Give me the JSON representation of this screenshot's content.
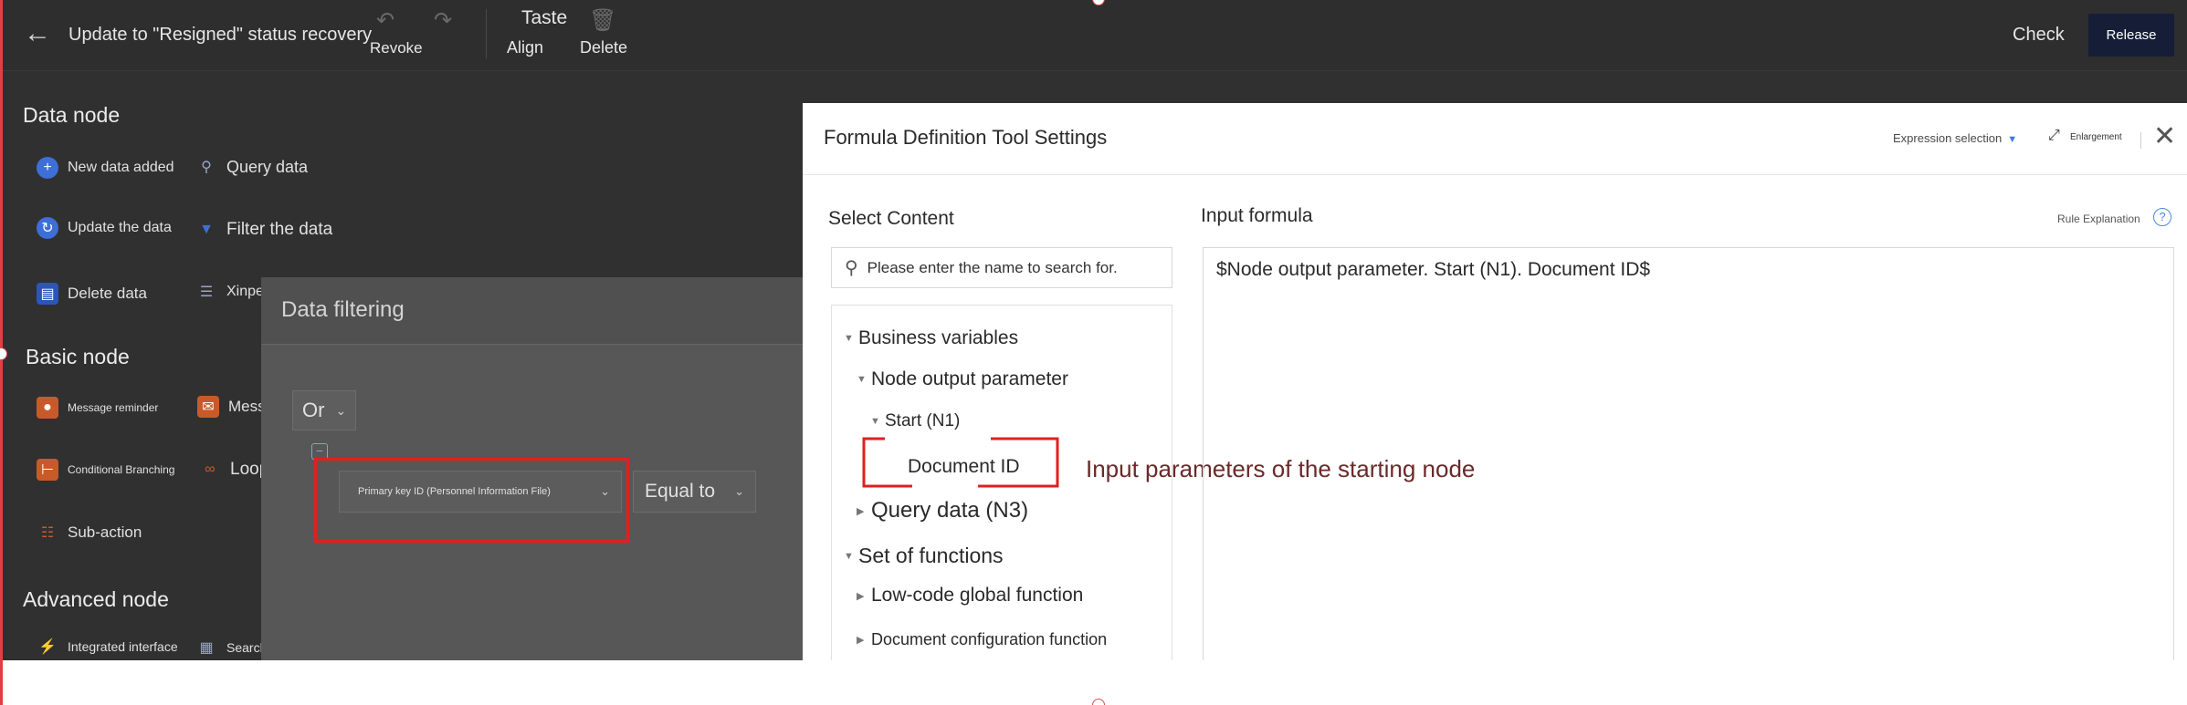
{
  "toolbar": {
    "title": "Update to \"Resigned\" status recovery",
    "revoke": "Revoke",
    "taste": "Taste",
    "align": "Align",
    "delete": "Delete",
    "check": "Check",
    "release": "Release"
  },
  "palette": {
    "data_node_title": "Data node",
    "data_node_items": [
      "New data added",
      "Query data",
      "Update the data",
      "Filter the data",
      "Delete data",
      "Xinpei"
    ],
    "basic_node_title": "Basic node",
    "basic_node_items": [
      "Message reminder",
      "Message",
      "Conditional Branching",
      "Loop",
      "Sub-action"
    ],
    "advanced_node_title": "Advanced node",
    "advanced_node_items": [
      "Integrated interface",
      "Search/query"
    ]
  },
  "filter_dialog": {
    "title": "Data filtering",
    "logic": "Or",
    "field": "Primary key ID (Personnel Information File)",
    "operator": "Equal to"
  },
  "formula_dialog": {
    "title": "Formula Definition Tool Settings",
    "expression_selection": "Expression selection",
    "enlargement": "Enlargement",
    "select_content": "Select Content",
    "search_placeholder": "Please enter the name to search for.",
    "tree": {
      "business_variables": "Business variables",
      "node_output_parameter": "Node output parameter",
      "start_n1": "Start (N1)",
      "document_id": "Document ID",
      "query_data_n3": "Query data (N3)",
      "set_of_functions": "Set of functions",
      "low_code_global_function": "Low-code global function",
      "document_configuration_function": "Document configuration function"
    },
    "annotation": "Input parameters of the starting node",
    "input_formula": "Input formula",
    "rule_explanation": "Rule Explanation",
    "formula_value": "$Node output parameter. Start (N1). Document ID$"
  },
  "colors": {
    "editor_bg": "#303030",
    "release_bg": "#151e36",
    "highlight_red": "#e02020",
    "accent_blue": "#3b7ae0"
  }
}
